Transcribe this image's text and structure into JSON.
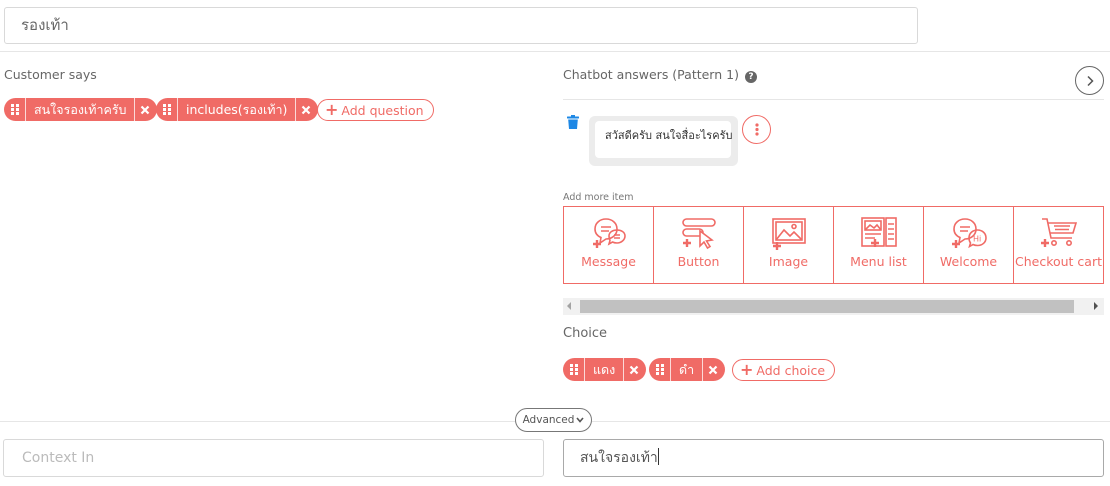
{
  "intent_name": "รองเท้า",
  "customer_says": {
    "label": "Customer says",
    "questions": [
      "สนใจรองเท้าครับ",
      "includes(รองเท้า)"
    ],
    "add_label": "Add question"
  },
  "chatbot": {
    "label": "Chatbot answers (Pattern 1)",
    "message": "สวัสดีครับ สนใจสื่อะไรครับ"
  },
  "add_more": {
    "label": "Add more item",
    "items": [
      {
        "label": "Message",
        "icon": "message-icon"
      },
      {
        "label": "Button",
        "icon": "button-icon"
      },
      {
        "label": "Image",
        "icon": "image-icon"
      },
      {
        "label": "Menu list",
        "icon": "menu-list-icon"
      },
      {
        "label": "Welcome",
        "icon": "welcome-icon"
      },
      {
        "label": "Checkout cart",
        "icon": "checkout-cart-icon"
      }
    ]
  },
  "choice": {
    "label": "Choice",
    "items": [
      "แดง",
      "ดำ"
    ],
    "add_label": "Add choice"
  },
  "advanced_label": "Advanced",
  "context_in_placeholder": "Context In",
  "answer_input_value": "สนใจรองเท้า",
  "colors": {
    "accent": "#f06b66",
    "trash": "#1e88e5"
  }
}
